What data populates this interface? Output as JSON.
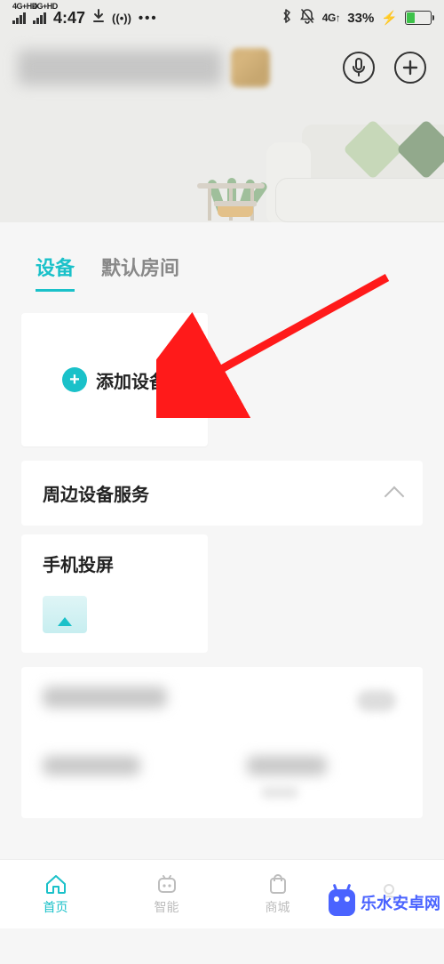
{
  "status_bar": {
    "net1_label": "4G+HD",
    "net2_label": "4G+HD",
    "time": "4:47",
    "net_indicator": "4G↑",
    "battery_pct": "33%"
  },
  "tabs": {
    "devices": "设备",
    "default_room": "默认房间"
  },
  "add_device": {
    "label": "添加设备"
  },
  "peripheral_services": {
    "title": "周边设备服务"
  },
  "screen_cast": {
    "title": "手机投屏"
  },
  "nav": {
    "home": "首页",
    "smart": "智能",
    "mall": "商城",
    "mine": ""
  },
  "watermark": {
    "text": "乐水安卓网"
  }
}
